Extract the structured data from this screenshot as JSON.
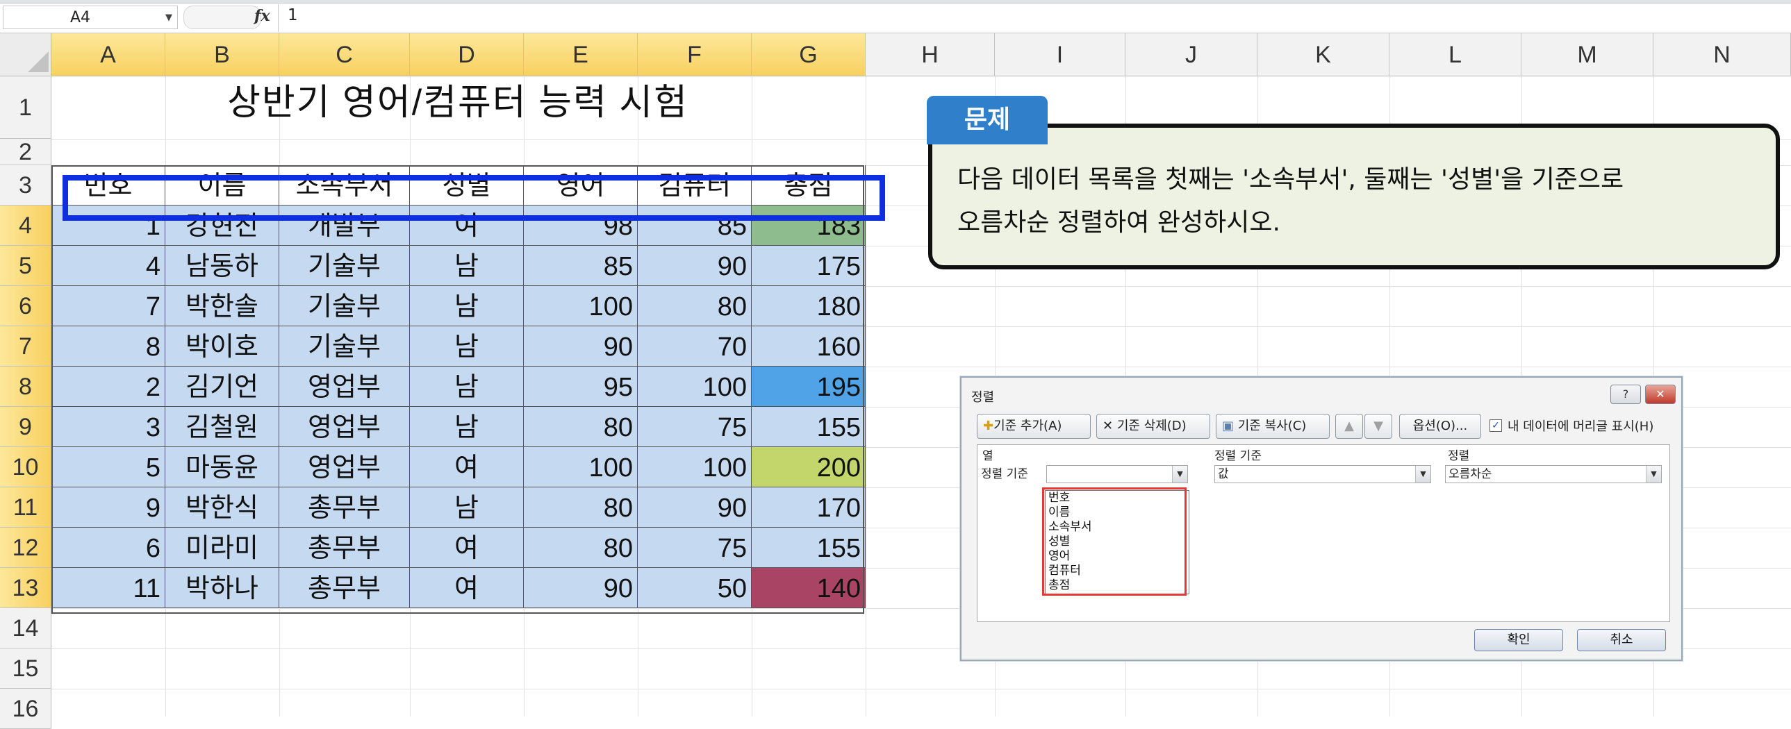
{
  "formula_bar": {
    "cell_ref": "A4",
    "fx_symbol": "fx",
    "value": "1"
  },
  "columns": [
    "A",
    "B",
    "C",
    "D",
    "E",
    "F",
    "G",
    "H",
    "I",
    "J",
    "K",
    "L",
    "M",
    "N"
  ],
  "rows": [
    "1",
    "2",
    "3",
    "4",
    "5",
    "6",
    "7",
    "8",
    "9",
    "10",
    "11",
    "12",
    "13",
    "14",
    "15",
    "16"
  ],
  "sheet": {
    "title": "상반기 영어/컴퓨터 능력 시험",
    "headers": [
      "번호",
      "이름",
      "소속부서",
      "성별",
      "영어",
      "컴퓨터",
      "총점"
    ],
    "data": [
      [
        "1",
        "강현진",
        "개발부",
        "여",
        "98",
        "85",
        "183"
      ],
      [
        "4",
        "남동하",
        "기술부",
        "남",
        "85",
        "90",
        "175"
      ],
      [
        "7",
        "박한솔",
        "기술부",
        "남",
        "100",
        "80",
        "180"
      ],
      [
        "8",
        "박이호",
        "기술부",
        "남",
        "90",
        "70",
        "160"
      ],
      [
        "2",
        "김기언",
        "영업부",
        "남",
        "95",
        "100",
        "195"
      ],
      [
        "3",
        "김철원",
        "영업부",
        "남",
        "80",
        "75",
        "155"
      ],
      [
        "5",
        "마동윤",
        "영업부",
        "여",
        "100",
        "100",
        "200"
      ],
      [
        "9",
        "박한식",
        "총무부",
        "남",
        "80",
        "90",
        "170"
      ],
      [
        "6",
        "미라미",
        "총무부",
        "여",
        "80",
        "75",
        "155"
      ],
      [
        "11",
        "박하나",
        "총무부",
        "여",
        "90",
        "50",
        "140"
      ]
    ],
    "total_colors": [
      "#8fbc8f",
      "#c5d9f1",
      "#c5d9f1",
      "#c5d9f1",
      "#4fa3e6",
      "#c5d9f1",
      "#c3d66b",
      "#c5d9f1",
      "#c5d9f1",
      "#a94464"
    ],
    "row_fill": "#c5d9f1"
  },
  "callout": {
    "tab": "문제",
    "line1": "다음 데이터 목록을 첫째는 '소속부서', 둘째는 '성별'을 기준으로",
    "line2": "오름차순 정렬하여 완성하시오."
  },
  "sort_dialog": {
    "title": "정렬",
    "help_label": "?",
    "close_label": "✕",
    "add_level": "기준 추가(A)",
    "delete_level": "기준 삭제(D)",
    "copy_level": "기준 복사(C)",
    "options": "옵션(O)...",
    "header_checkbox": "내 데이터에 머리글 표시(H)",
    "col_header_column": "열",
    "col_header_sort_on": "정렬 기준",
    "col_header_order": "정렬",
    "row_label": "정렬 기준",
    "sort_on_value": "값",
    "order_value": "오름차순",
    "dropdown_items": [
      "번호",
      "이름",
      "소속부서",
      "성별",
      "영어",
      "컴퓨터",
      "총점"
    ],
    "ok": "확인",
    "cancel": "취소"
  }
}
